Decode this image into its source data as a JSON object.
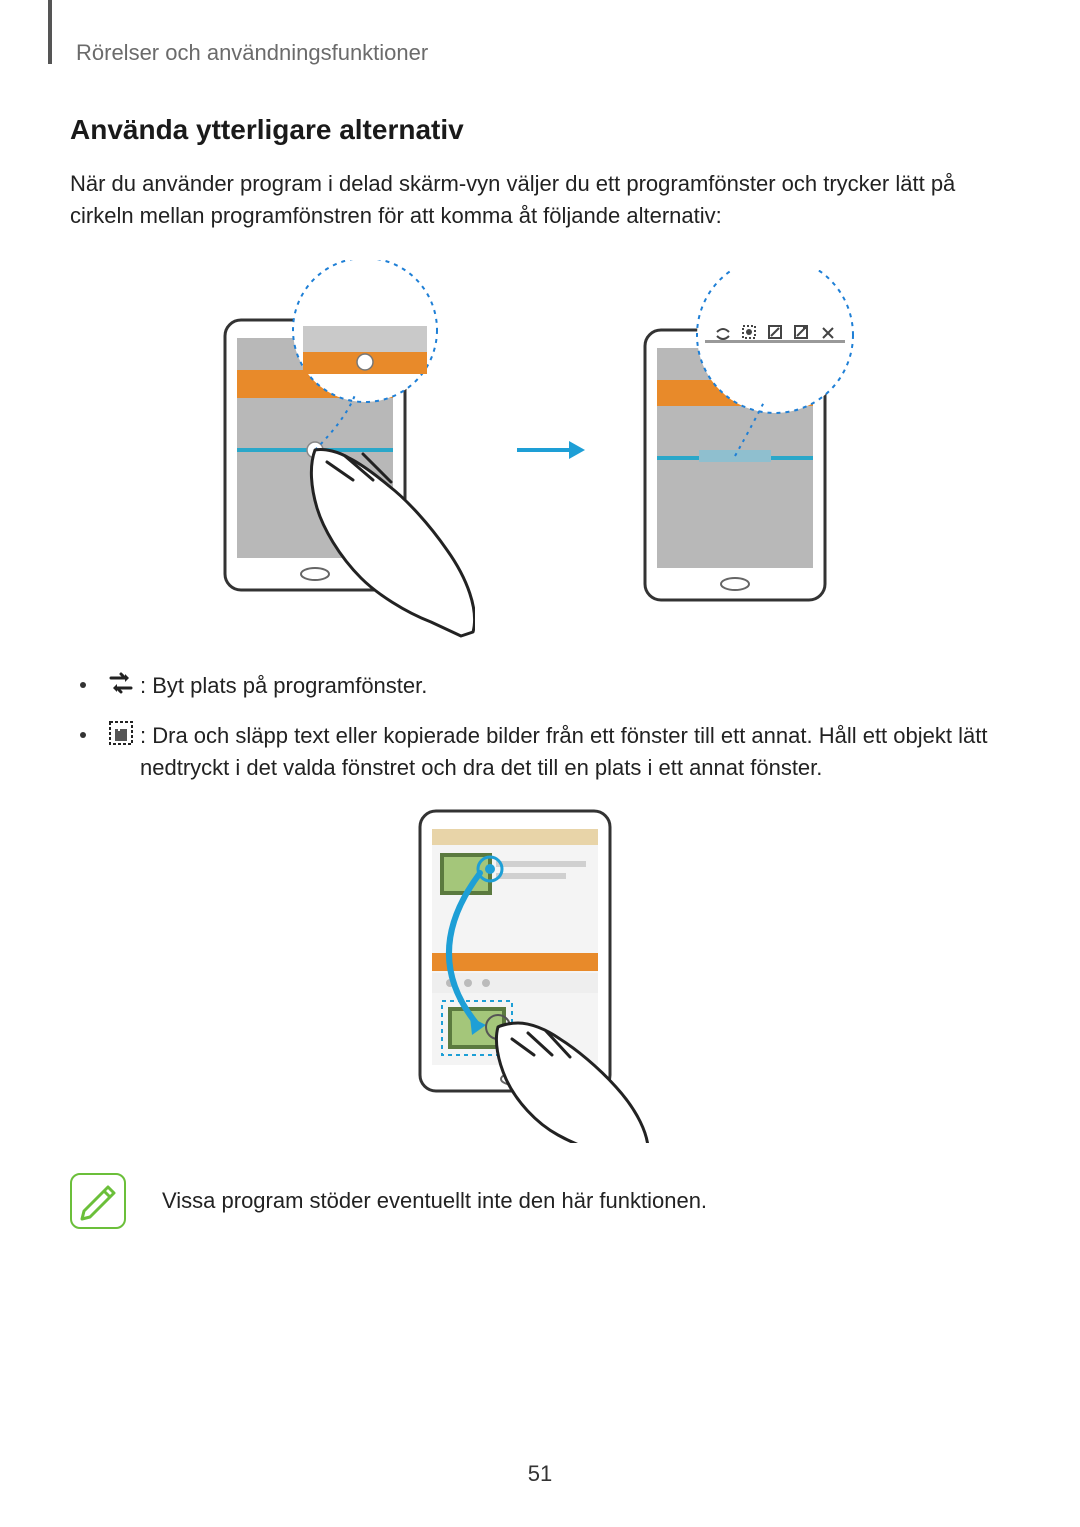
{
  "breadcrumb": "Rörelser och användningsfunktioner",
  "section_title": "Använda ytterligare alternativ",
  "intro": "När du använder program i delad skärm-vyn väljer du ett programfönster och trycker lätt på cirkeln mellan programfönstren för att komma åt följande alternativ:",
  "bullets": [
    {
      "icon": "swap-icon",
      "text": " : Byt plats på programfönster."
    },
    {
      "icon": "drag-drop-icon",
      "text": " : Dra och släpp text eller kopierade bilder från ett fönster till ett annat. Håll ett objekt lätt nedtryckt i det valda fönstret och dra det till en plats i ett annat fönster."
    }
  ],
  "note": "Vissa program stöder eventuellt inte den här funktionen.",
  "page_number": "51"
}
